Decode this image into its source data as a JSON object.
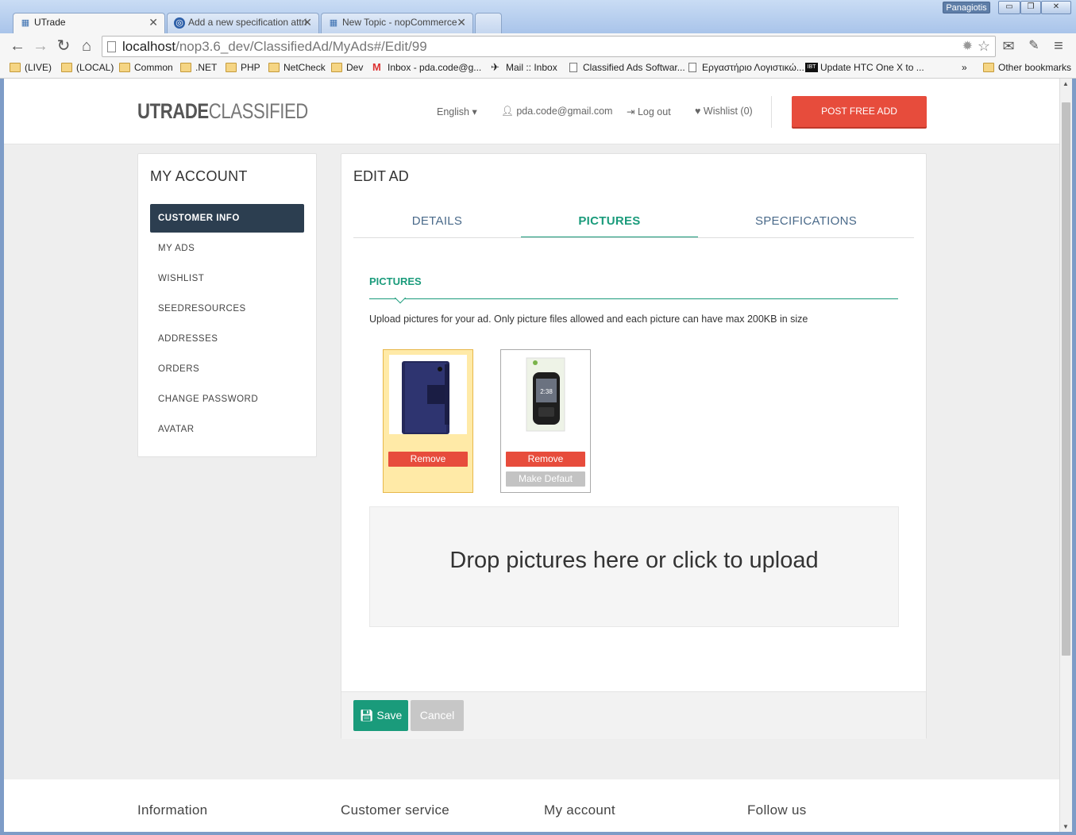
{
  "window": {
    "user": "Panagiotis",
    "min": "▭",
    "max": "❐",
    "close": "✕"
  },
  "tabs": [
    {
      "label": "UTrade",
      "icon": "utrade-favicon",
      "close": "✕"
    },
    {
      "label": "Add a new specification attri",
      "icon": "nopcommerce-favicon",
      "close": "✕"
    },
    {
      "label": "New Topic - nopCommerce",
      "icon": "utrade-favicon",
      "close": "✕"
    }
  ],
  "toolbar": {
    "back": "←",
    "forward": "→",
    "reload": "↻",
    "home": "⌂",
    "url_host": "localhost",
    "url_path": "/nop3.6_dev/ClassifiedAd/MyAds#/Edit/99",
    "star": "☆",
    "mail": "✉",
    "menu": "≡"
  },
  "bookmarks": [
    {
      "label": "(LIVE)",
      "type": "folder"
    },
    {
      "label": "(LOCAL)",
      "type": "folder"
    },
    {
      "label": "Common",
      "type": "folder"
    },
    {
      "label": ".NET",
      "type": "folder"
    },
    {
      "label": "PHP",
      "type": "folder"
    },
    {
      "label": "NetCheck",
      "type": "folder"
    },
    {
      "label": "Dev",
      "type": "folder"
    },
    {
      "label": "Inbox - pda.code@g...",
      "type": "gmail"
    },
    {
      "label": "Mail :: Inbox",
      "type": "page"
    },
    {
      "label": "Classified Ads Softwar...",
      "type": "page"
    },
    {
      "label": "Εργαστήριο Λογιστικώ...",
      "type": "page"
    },
    {
      "label": "Update HTC One X to ...",
      "type": "ibt"
    },
    {
      "label": "»",
      "type": "more"
    },
    {
      "label": "Other bookmarks",
      "type": "folder"
    }
  ],
  "header": {
    "logo_bold": "UTRADE",
    "logo_light": "CLASSIFIED",
    "language": "English ▾",
    "email": "pda.code@gmail.com",
    "logout": "Log out",
    "wishlist": "Wishlist (0)",
    "post_button": "POST FREE ADD"
  },
  "account": {
    "title": "MY ACCOUNT",
    "items": [
      "CUSTOMER INFO",
      "MY ADS",
      "WISHLIST",
      "SEEDRESOURCES",
      "ADDRESSES",
      "ORDERS",
      "CHANGE PASSWORD",
      "AVATAR"
    ]
  },
  "edit": {
    "title": "EDIT AD",
    "tabs": [
      "DETAILS",
      "PICTURES",
      "SPECIFICATIONS"
    ],
    "pictures_heading": "PICTURES",
    "pictures_desc": "Upload pictures for your ad. Only picture files allowed and each picture can have max 200KB in size",
    "remove_label": "Remove",
    "make_default_label": "Make Defaut",
    "phone_time": "2:38",
    "dropzone": "Drop pictures here or click to upload",
    "save": "Save",
    "cancel": "Cancel"
  },
  "footer": {
    "columns": [
      "Information",
      "Customer service",
      "My account",
      "Follow us"
    ]
  },
  "colors": {
    "accent": "#1a9b7b",
    "danger": "#e74c3c",
    "dark": "#2c3e50"
  }
}
